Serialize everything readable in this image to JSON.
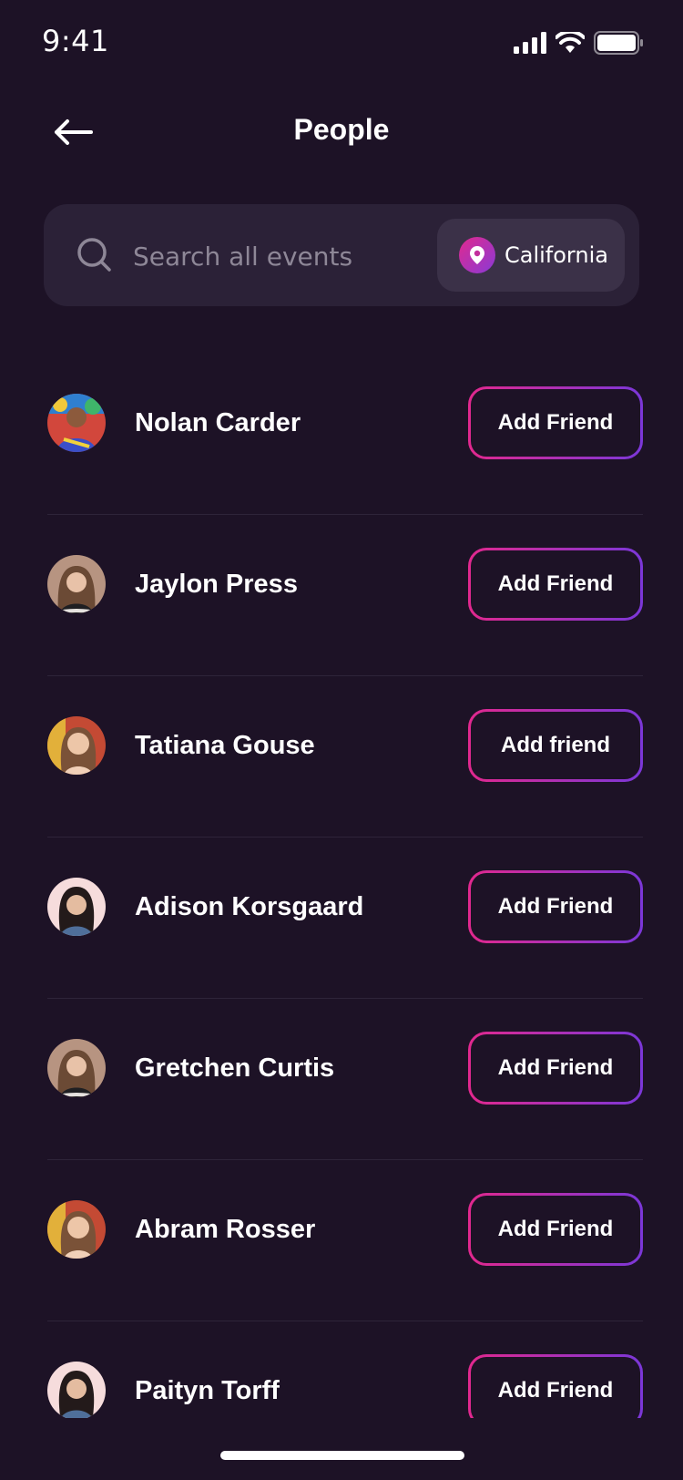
{
  "status_bar": {
    "time": "9:41"
  },
  "header": {
    "title": "People"
  },
  "search": {
    "placeholder": "Search all events",
    "location": "California"
  },
  "people": [
    {
      "name": "Nolan Carder",
      "button": "Add Friend"
    },
    {
      "name": "Jaylon Press",
      "button": "Add Friend"
    },
    {
      "name": "Tatiana Gouse",
      "button": "Add friend"
    },
    {
      "name": "Adison Korsgaard",
      "button": "Add Friend"
    },
    {
      "name": "Gretchen Curtis",
      "button": "Add Friend"
    },
    {
      "name": "Abram Rosser",
      "button": "Add Friend"
    },
    {
      "name": "Paityn Torff",
      "button": "Add Friend"
    }
  ],
  "colors": {
    "background": "#1d1226",
    "accent_start": "#e2288e",
    "accent_end": "#7b37d9"
  }
}
